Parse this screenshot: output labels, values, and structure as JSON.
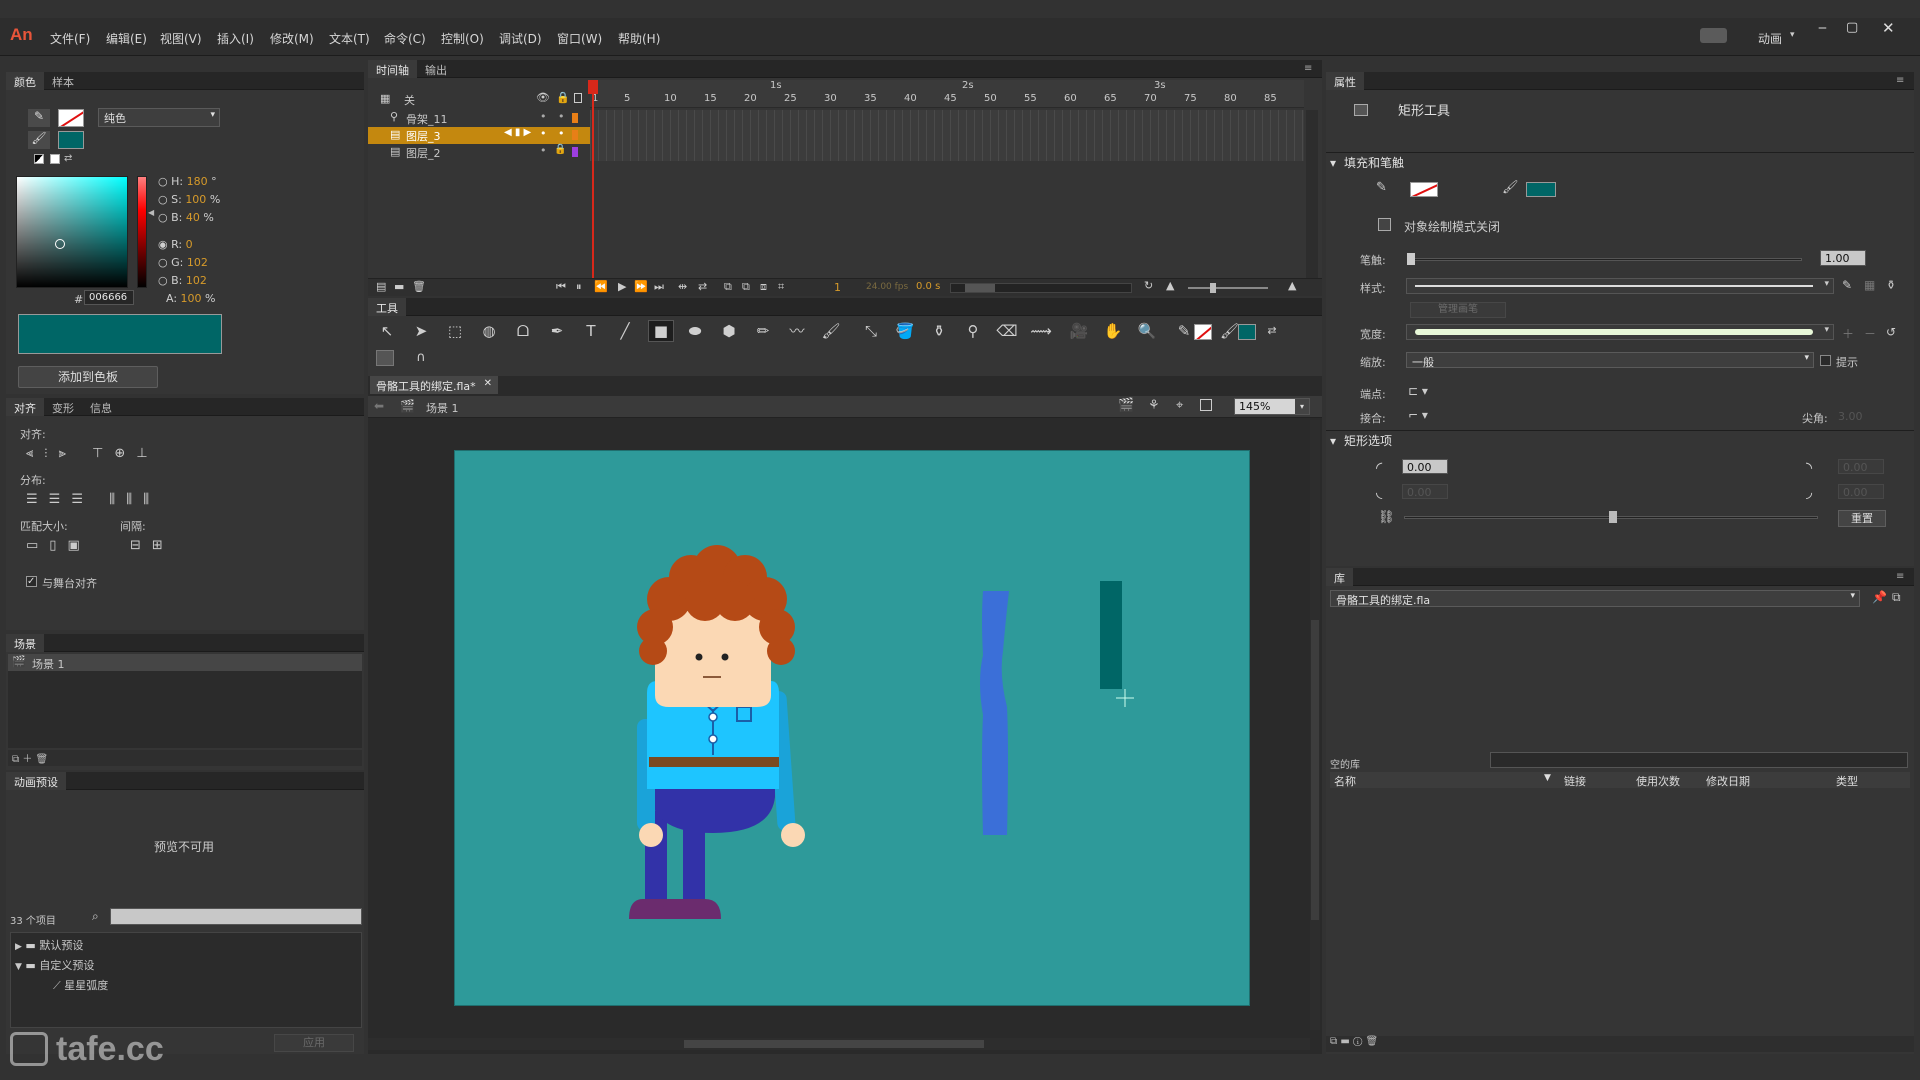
{
  "app": {
    "logo": "An",
    "menus": [
      "文件(F)",
      "编辑(E)",
      "视图(V)",
      "插入(I)",
      "修改(M)",
      "文本(T)",
      "命令(C)",
      "控制(O)",
      "调试(D)",
      "窗口(W)",
      "帮助(H)"
    ],
    "workspace": "动画",
    "watermark": "tafe.cc"
  },
  "color_panel": {
    "tabs": [
      "颜色",
      "样本"
    ],
    "fill_type": "纯色",
    "h_label": "H:",
    "h_value": "180",
    "h_unit": "°",
    "s_label": "S:",
    "s_value": "100",
    "s_unit": "%",
    "b_label": "B:",
    "b_value": "40",
    "b_unit": "%",
    "r_label": "R:",
    "r_value": "0",
    "g_label": "G:",
    "g_value": "102",
    "bl_label": "B:",
    "bl_value": "102",
    "a_label": "A:",
    "a_value": "100",
    "a_unit": "%",
    "hex_prefix": "#",
    "hex_value": "006666",
    "add_swatch": "添加到色板",
    "swatch_color": "#006666"
  },
  "align_panel": {
    "tabs": [
      "对齐",
      "变形",
      "信息"
    ],
    "align_label": "对齐:",
    "distribute_label": "分布:",
    "match_label": "匹配大小:",
    "spacing_label": "间隔:",
    "stage_align": "与舞台对齐"
  },
  "scene_panel": {
    "title": "场景",
    "item": "场景 1"
  },
  "presets_panel": {
    "title": "动画预设",
    "preview": "预览不可用",
    "count": "33 个项目",
    "folder_default": "默认预设",
    "folder_custom": "自定义预设",
    "item": "星星弧度",
    "apply": "应用"
  },
  "timeline": {
    "tabs": [
      "时间轴",
      "输出"
    ],
    "layers": [
      {
        "name": "关",
        "type": "header"
      },
      {
        "name": "骨架_11",
        "color": "#e87f17"
      },
      {
        "name": "图层_3",
        "color": "#e87f17"
      },
      {
        "name": "图层_2",
        "color": "#9d3ee0"
      }
    ],
    "ruler_secs": [
      "1s",
      "2s",
      "3s"
    ],
    "ruler_frames": [
      "1",
      "5",
      "10",
      "15",
      "20",
      "25",
      "30",
      "35",
      "40",
      "45",
      "50",
      "55",
      "60",
      "65",
      "70",
      "75",
      "80",
      "85"
    ],
    "frame": "1",
    "fps": "24.00 fps",
    "time": "0.0 s"
  },
  "tools": {
    "title": "工具"
  },
  "document": {
    "tab": "骨骼工具的绑定.fla*",
    "scene": "场景 1",
    "zoom": "145%",
    "stage_color": "#2e9a9a"
  },
  "properties": {
    "title": "属性",
    "tool_name": "矩形工具",
    "fill_stroke": "填充和笔触",
    "draw_mode": "对象绘制模式关闭",
    "stroke_label": "笔触:",
    "stroke_value": "1.00",
    "style_label": "样式:",
    "manage_brush": "管理画笔",
    "width_label": "宽度:",
    "scale_label": "缩放:",
    "scale_value": "一般",
    "hint": "提示",
    "cap_label": "端点:",
    "join_label": "接合:",
    "miter_label": "尖角:",
    "miter_value": "3.00",
    "rect_options": "矩形选项",
    "corner_value": "0.00",
    "corner_dim": "0.00",
    "reset": "重置"
  },
  "library": {
    "title": "库",
    "file": "骨骼工具的绑定.fla",
    "empty": "空的库",
    "columns": [
      "名称",
      "链接",
      "使用次数",
      "修改日期",
      "类型"
    ]
  }
}
